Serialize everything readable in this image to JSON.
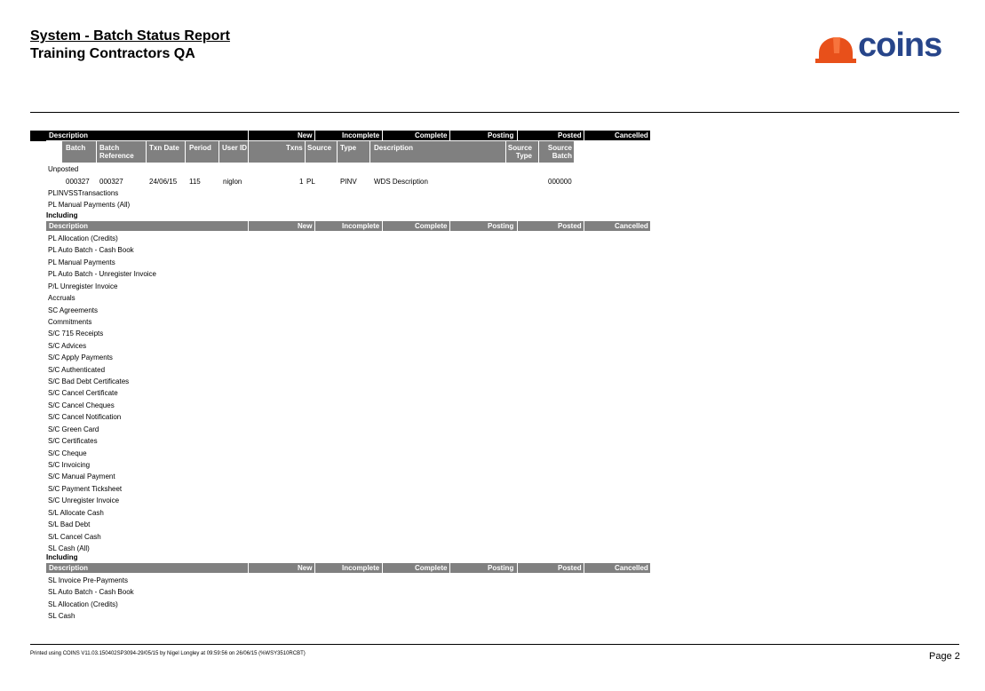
{
  "report": {
    "title": "System - Batch Status Report",
    "subtitle": "Training Contractors QA",
    "logo_text": "coins"
  },
  "header": {
    "description": "Description",
    "new": "New",
    "incomplete": "Incomplete",
    "complete": "Complete",
    "posting": "Posting",
    "posted": "Posted",
    "cancelled": "Cancelled"
  },
  "subheader": {
    "batch": "Batch",
    "batch_reference_1": "Batch",
    "batch_reference_2": "Reference",
    "txn_date": "Txn Date",
    "period": "Period",
    "user_id": "User ID",
    "txns": "Txns",
    "source": "Source",
    "type": "Type",
    "description": "Description",
    "source_type_1": "Source",
    "source_type_2": "Type",
    "source_batch_1": "Source",
    "source_batch_2": "Batch"
  },
  "unposted_label": "Unposted",
  "batch_row": {
    "batch": "000327",
    "reference": "000327",
    "txn_date": "24/06/15",
    "period": "115",
    "user_id": "niglon",
    "txns": "1",
    "source": "PL",
    "type": "PINV",
    "description": "WDS Description",
    "source_batch": "000000"
  },
  "group1_items": [
    "PLINVSSTransactions",
    "PL Manual Payments (All)"
  ],
  "including_label": "Including",
  "group2_items": [
    "PL Allocation (Credits)",
    "PL Auto Batch - Cash Book",
    "PL Manual Payments",
    "PL Auto Batch - Unregister Invoice",
    "P/L Unregister Invoice",
    "Accruals",
    "SC Agreements",
    "Commitments",
    "S/C 715 Receipts",
    "S/C Advices",
    "S/C Apply Payments",
    "S/C Authenticated",
    "S/C Bad Debt Certificates",
    "S/C Cancel Certificate",
    "S/C Cancel Cheques",
    "S/C Cancel Notification",
    "S/C Green Card",
    "S/C Certificates",
    "S/C Cheque",
    "S/C Invoicing",
    "S/C Manual Payment",
    "S/C Payment Ticksheet",
    "S/C Unregister Invoice",
    "S/L Allocate Cash",
    "S/L Bad Debt",
    "S/L Cancel Cash",
    "SL Cash (All)"
  ],
  "group3_items": [
    "SL Invoice Pre-Payments",
    "SL Auto Batch - Cash Book",
    "SL Allocation (Credits)",
    "SL Cash"
  ],
  "footer": {
    "printed": "Printed using COINS V11.03.150402SP3094-29/05/15 by Nigel Longley at 09:59:56 on 26/06/15 (%WSY3510RCBT)",
    "page": "Page 2"
  },
  "colors": {
    "header_black": "#000000",
    "header_grey": "#808080",
    "logo_blue": "#27458a",
    "logo_orange": "#e8501a"
  }
}
